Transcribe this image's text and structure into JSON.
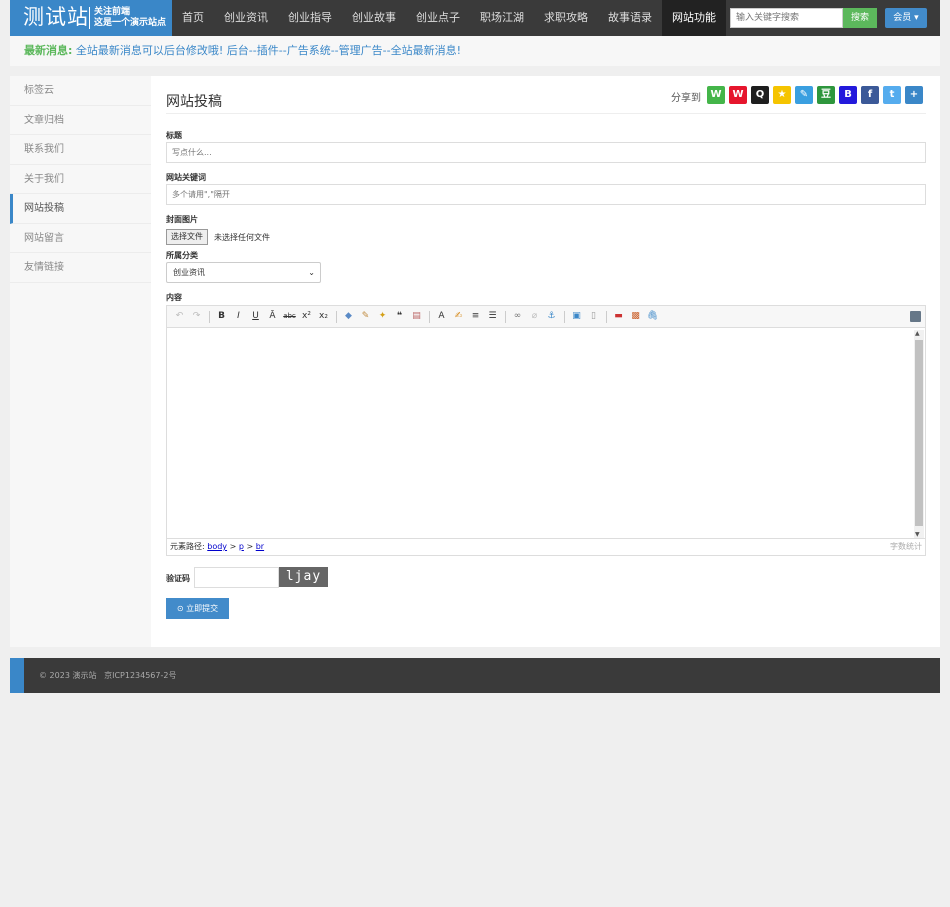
{
  "header": {
    "logo_main": "测试站",
    "logo_line1": "关注前端",
    "logo_line2": "这是一个演示站点",
    "nav": [
      "首页",
      "创业资讯",
      "创业指导",
      "创业故事",
      "创业点子",
      "职场江湖",
      "求职攻略",
      "故事语录",
      "网站功能"
    ],
    "active_nav": "网站功能",
    "search_placeholder": "输入关键字搜索",
    "search_button": "搜索",
    "member_button": "会员"
  },
  "news": {
    "label": "最新消息:",
    "text": "全站最新消息可以后台修改哦! 后台--插件--广告系统--管理广告--全站最新消息!"
  },
  "sidebar": {
    "items": [
      "标签云",
      "文章归档",
      "联系我们",
      "关于我们",
      "网站投稿",
      "网站留言",
      "友情链接"
    ],
    "active": "网站投稿"
  },
  "form": {
    "page_title": "网站投稿",
    "share_label": "分享到",
    "share_icons": [
      {
        "name": "wechat",
        "color": "#44b549",
        "glyph": "W"
      },
      {
        "name": "weibo",
        "color": "#e6162d",
        "glyph": "W"
      },
      {
        "name": "qq",
        "color": "#1e1e1e",
        "glyph": "Q"
      },
      {
        "name": "qzone",
        "color": "#f5c400",
        "glyph": "★"
      },
      {
        "name": "tqq",
        "color": "#3a9fe0",
        "glyph": "✎"
      },
      {
        "name": "douban",
        "color": "#2e963d",
        "glyph": "豆"
      },
      {
        "name": "baidu",
        "color": "#2319dc",
        "glyph": "B"
      },
      {
        "name": "facebook",
        "color": "#3b5998",
        "glyph": "f"
      },
      {
        "name": "twitter",
        "color": "#55acee",
        "glyph": "t"
      },
      {
        "name": "more",
        "color": "#3a87c8",
        "glyph": "+"
      }
    ],
    "title_label": "标题",
    "title_placeholder": "写点什么...",
    "keywords_label": "网站关键词",
    "keywords_placeholder": "多个请用\",\"隔开",
    "cover_label": "封面图片",
    "file_button": "选择文件",
    "file_status": "未选择任何文件",
    "category_label": "所属分类",
    "category_value": "创业资讯",
    "content_label": "内容",
    "editor_path_label": "元素路径:",
    "editor_path": [
      "body",
      "p",
      "br"
    ],
    "word_count_label": "字数统计",
    "captcha_label": "验证码",
    "captcha_text": "ljay",
    "submit_label": "立即提交"
  },
  "footer": {
    "copyright": "© 2023 演示站",
    "icp": "京ICP1234567-2号"
  }
}
